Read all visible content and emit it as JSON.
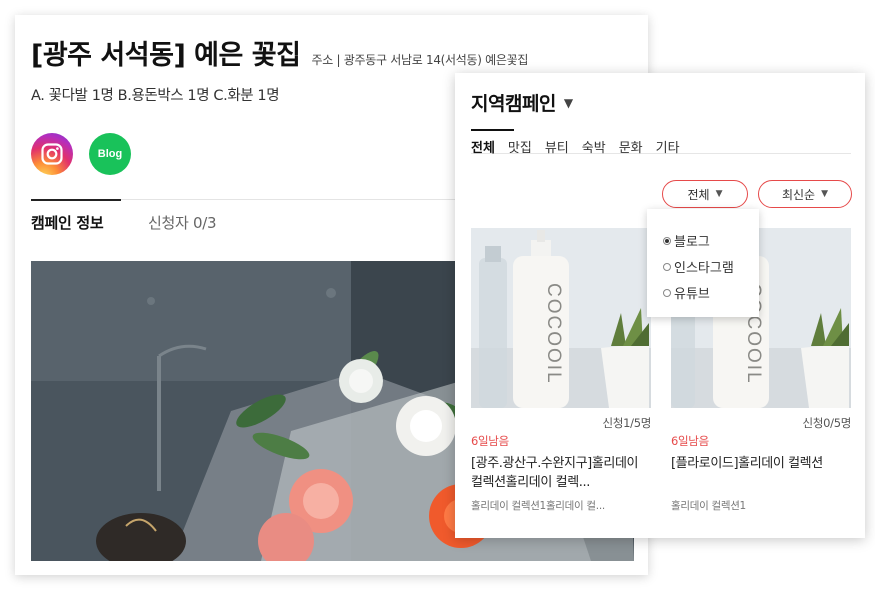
{
  "detail": {
    "title": "[광주 서석동] 예은 꽃집",
    "address": "주소 | 광주동구 서남로 14(서석동) 예은꽃집",
    "reward": "A. 꽃다발 1명 B.용돈박스 1명 C.화분 1명",
    "sns": [
      {
        "name": "instagram",
        "icon": "instagram-icon"
      },
      {
        "name": "blog",
        "icon": "blog-icon",
        "label": "Blog"
      }
    ],
    "tabs": {
      "info": "캠페인 정보",
      "applicants": "신청자 0/3"
    }
  },
  "region": {
    "title": "지역캠페인",
    "tabs": [
      "전체",
      "맛집",
      "뷰티",
      "숙박",
      "문화",
      "기타"
    ],
    "filter_label": "전체",
    "sort_label": "최신순",
    "filter_options": [
      {
        "label": "블로그",
        "selected": true
      },
      {
        "label": "인스타그램",
        "selected": false
      },
      {
        "label": "유튜브",
        "selected": false
      }
    ],
    "products": [
      {
        "applicants": "신청1/5명",
        "days_left": "6일남음",
        "title": "[광주.광산구.수완지구]홀리데이 컬렉션홀리데이 컬렉...",
        "desc": "홀리데이 컬렉션1홀리데이 컬..."
      },
      {
        "applicants": "신청0/5명",
        "days_left": "6일남음",
        "title": "[플라로이드]홀리데이 컬렉션",
        "desc": "홀리데이 컬렉션1"
      }
    ],
    "bottle_label": "COCOOIL"
  },
  "colors": {
    "accent_red": "#e64a4a",
    "blog_green": "#19c25a"
  }
}
